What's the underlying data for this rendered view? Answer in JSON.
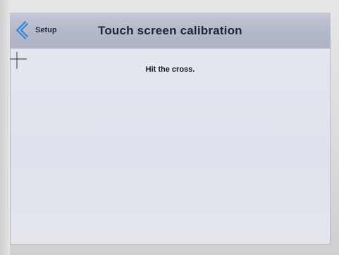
{
  "header": {
    "back_label": "Setup",
    "title": "Touch screen calibration"
  },
  "main": {
    "instruction": "Hit the cross."
  },
  "icons": {
    "back": "chevron-left-icon",
    "target": "crosshair-icon"
  },
  "colors": {
    "title_bar": "#b4b9cb",
    "screen_bg": "#e1e5ee",
    "back_chevron": "#4f8fd6"
  }
}
